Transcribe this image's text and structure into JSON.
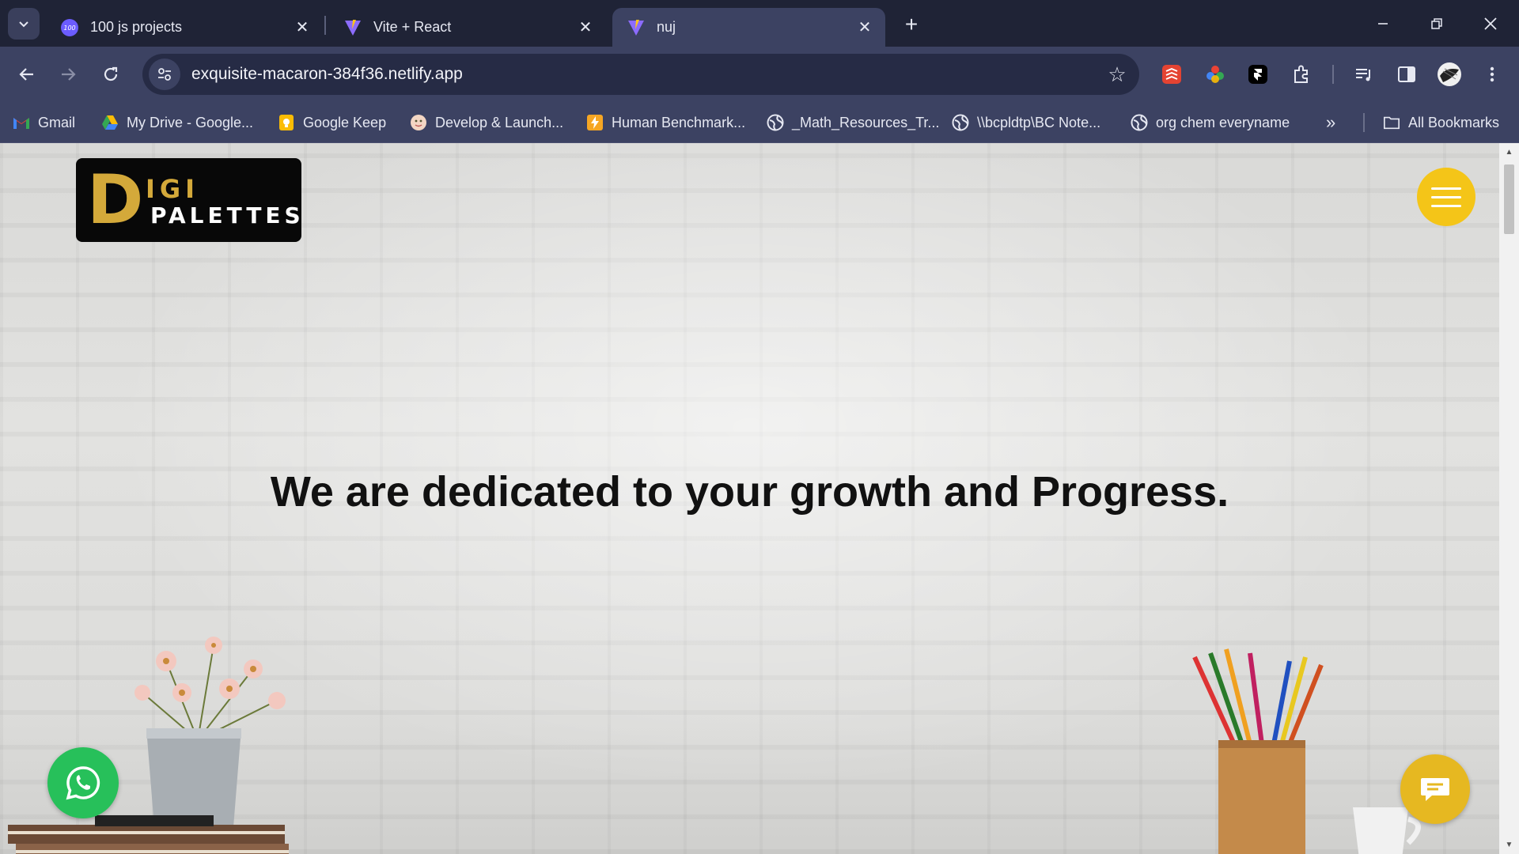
{
  "tabs": [
    {
      "title": "100 js projects",
      "icon": "100-badge-icon",
      "active": false
    },
    {
      "title": "Vite + React",
      "icon": "vite-icon",
      "active": false
    },
    {
      "title": "nuj",
      "icon": "vite-icon",
      "active": true
    }
  ],
  "toolbar": {
    "url": "exquisite-macaron-384f36.netlify.app"
  },
  "bookmarks": [
    {
      "label": "Gmail",
      "icon": "gmail-icon"
    },
    {
      "label": "My Drive - Google...",
      "icon": "drive-icon"
    },
    {
      "label": "Google Keep",
      "icon": "keep-icon"
    },
    {
      "label": "Develop & Launch...",
      "icon": "avatar-icon"
    },
    {
      "label": "Human Benchmark...",
      "icon": "lightning-icon"
    },
    {
      "label": "_Math_Resources_Tr...",
      "icon": "globe-icon"
    },
    {
      "label": "\\\\bcpldtp\\BC Note...",
      "icon": "globe-icon"
    },
    {
      "label": "org chem everyname",
      "icon": "globe-icon"
    }
  ],
  "bookmarks_all": "All Bookmarks",
  "page": {
    "logo": {
      "d": "D",
      "igi": "IGI",
      "palettes": "PALETTES"
    },
    "hero_title": "We are dedicated to your growth and Progress."
  },
  "colors": {
    "accent_yellow": "#f4c518",
    "whatsapp_green": "#27c05a",
    "browser_dark": "#1f2336",
    "browser_toolbar": "#3c4262"
  }
}
